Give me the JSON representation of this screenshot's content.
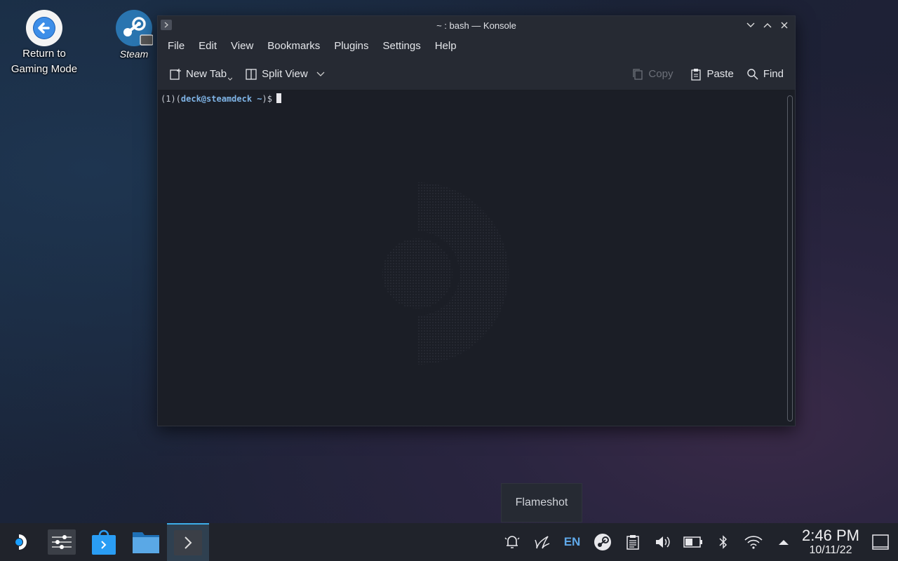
{
  "desktop": {
    "icons": [
      {
        "label": "Return to\nGaming Mode",
        "icon": "back-arrow-icon"
      },
      {
        "label": "Steam",
        "icon": "steam-icon"
      }
    ]
  },
  "window": {
    "title": "~ : bash — Konsole",
    "menu": [
      "File",
      "Edit",
      "View",
      "Bookmarks",
      "Plugins",
      "Settings",
      "Help"
    ],
    "toolbar": {
      "new_tab": "New Tab",
      "split_view": "Split View",
      "copy": "Copy",
      "paste": "Paste",
      "find": "Find"
    },
    "terminal": {
      "prompt_prefix": "(1)(",
      "prompt_user": "deck@steamdeck",
      "prompt_path": " ~",
      "prompt_suffix": ")$"
    }
  },
  "tooltip": {
    "text": "Flameshot"
  },
  "taskbar": {
    "tasks": [
      "application-launcher",
      "system-settings",
      "discover",
      "file-manager",
      "konsole"
    ],
    "tray": {
      "lang": "EN",
      "icons": [
        "notifications-icon",
        "flameshot-icon",
        "steam-icon",
        "clipboard-icon",
        "volume-icon",
        "battery-icon",
        "bluetooth-icon",
        "wifi-icon",
        "expand-tray-icon"
      ]
    },
    "clock": {
      "time": "2:46 PM",
      "date": "10/11/22"
    }
  },
  "colors": {
    "accent": "#3daee9",
    "window_bg": "#1b1e26",
    "taskbar_bg": "#20232b"
  }
}
